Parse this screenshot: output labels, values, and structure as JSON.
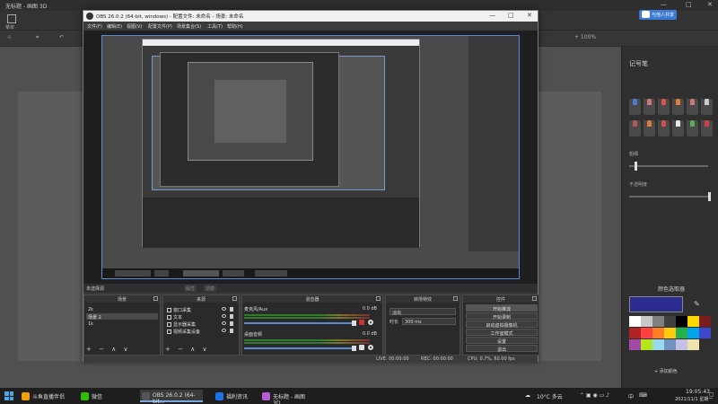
{
  "paint3d": {
    "title": "无标题 - 画图 3D",
    "menu_label": "菜单",
    "share_label": "与他人共享",
    "zoom_label": "+  100%",
    "panel_title": "记号笔",
    "thickness_label": "粗细",
    "opacity_label": "不透明度",
    "color_label": "颜色选取器",
    "add_color_label": "+ 添加颜色",
    "palette": [
      "#ffffff",
      "#c8c8c8",
      "#808080",
      "#404040",
      "#000000",
      "#ffd800",
      "#7a1c1c",
      "#b22222",
      "#ff4040",
      "#ff7f27",
      "#ffc90e",
      "#22b14c",
      "#00a2e8",
      "#3f48cc",
      "#a349a4",
      "#b5e61d",
      "#99d9ea",
      "#7092be",
      "#c8bfe7",
      "#efe4b0"
    ],
    "brush_colors": [
      "#4a7bd5",
      "#c77",
      "#d9534f",
      "#e07b39",
      "#c77",
      "#ccc",
      "#b05a5a",
      "#d97a3f",
      "#d05050",
      "#e8e8e8",
      "#5aaa5a",
      "#d04040"
    ]
  },
  "obs": {
    "title": "OBS 26.0.2 (64-bit, windows) - 配置文件: 未命名 - 场景: 未命名",
    "menu": [
      "文件(F)",
      "编辑(E)",
      "视图(V)",
      "配置文件(P)",
      "场景集合(S)",
      "工具(T)",
      "帮助(H)"
    ],
    "context_label": "未选择源",
    "context_buttons": [
      "属性",
      "滤镜"
    ],
    "docks": {
      "scenes": {
        "title": "场景",
        "items": [
          "2k",
          "场景 2",
          "1k"
        ],
        "selected": 1
      },
      "sources": {
        "title": "来源",
        "items": [
          "窗口采集",
          "文本",
          "显示器采集",
          "视频采集设备"
        ]
      },
      "mixer": {
        "title": "混音器",
        "channels": [
          {
            "name": "麦克风/Aux",
            "db": "0.0 dB"
          },
          {
            "name": "桌面音频",
            "db": "0.0 dB"
          }
        ]
      },
      "transitions": {
        "title": "转场特效",
        "type": "淡出",
        "duration_label": "时长",
        "duration_value": "300 ms"
      },
      "controls": {
        "title": "控件",
        "buttons": [
          "开始推流",
          "开始录制",
          "启动虚拟摄像机",
          "工作室模式",
          "设置",
          "退出"
        ]
      }
    },
    "status": {
      "live": "LIVE: 00:00:00",
      "rec": "REC: 00:00:00",
      "cpu": "CPU: 0.7%, 60.00 fps"
    },
    "dock_footer": "+ − ∧ ∨"
  },
  "taskbar": {
    "items": [
      {
        "label": "斗鱼直播伴侣",
        "color": "#f29f05"
      },
      {
        "label": "微信",
        "color": "#2dc100"
      },
      {
        "label": "OBS 26.0.2 (64-bit...",
        "color": "#555"
      },
      {
        "label": "福利资讯",
        "color": "#1a73e8"
      },
      {
        "label": "无标题 - 画图 3D",
        "color": "#b55bd8"
      }
    ],
    "active_index": 2,
    "weather": "10°C 多云",
    "ime": "中",
    "time": "19:05:43",
    "date": "2021/11/1 星期一"
  }
}
